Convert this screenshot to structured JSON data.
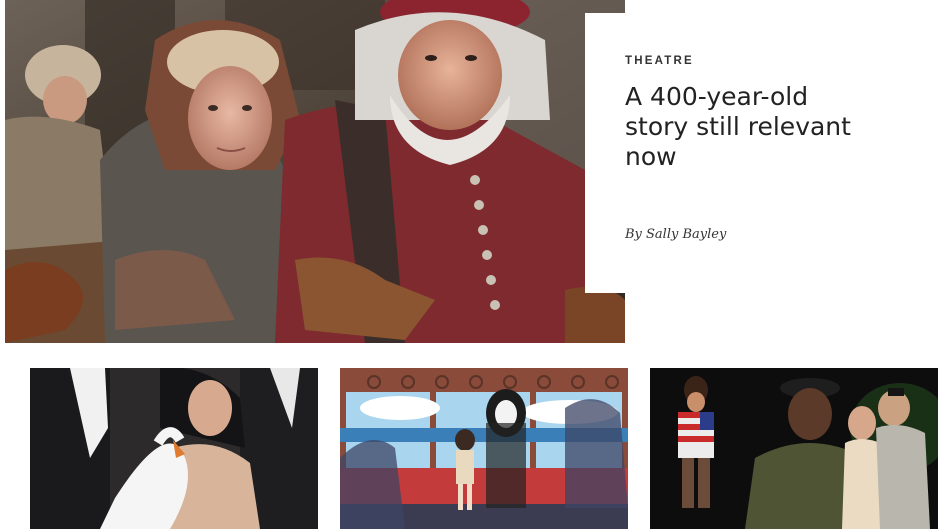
{
  "feature": {
    "category": "THEATRE",
    "headline": "A 400-year-old story still relevant now",
    "byline": "By Sally Bayley",
    "image": "theatre-scene-photo"
  },
  "tiles": [
    {
      "image": "performer-swan-dress-photo"
    },
    {
      "image": "animated-train-scene-still"
    },
    {
      "image": "stage-performers-photo"
    }
  ],
  "colors": {
    "card_background": "#ffffff",
    "text_primary": "#222222",
    "kicker_text": "#333333"
  }
}
